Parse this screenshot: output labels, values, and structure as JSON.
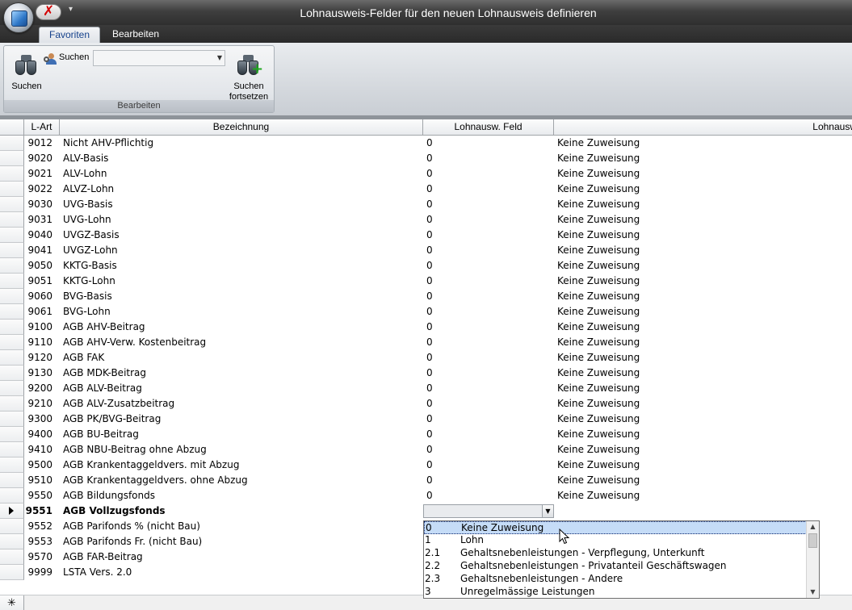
{
  "window": {
    "title": "Lohnausweis-Felder für den neuen Lohnausweis definieren"
  },
  "qat": {
    "menu_glyph": "▾"
  },
  "tabs": [
    {
      "label": "Favoriten"
    },
    {
      "label": "Bearbeiten"
    }
  ],
  "ribbon": {
    "search_button": "Suchen",
    "search_label": "Suchen",
    "search_value": "",
    "continue_button_line1": "Suchen",
    "continue_button_line2": "fortsetzen",
    "group_label": "Bearbeiten"
  },
  "grid": {
    "columns": [
      "L-Art",
      "Bezeichnung",
      "Lohnausw. Feld",
      "Lohnausw"
    ],
    "rows": [
      {
        "lart": "9012",
        "bez": "Nicht AHV-Pflichtig",
        "feld": "0",
        "text": "Keine Zuweisung"
      },
      {
        "lart": "9020",
        "bez": "ALV-Basis",
        "feld": "0",
        "text": "Keine Zuweisung"
      },
      {
        "lart": "9021",
        "bez": "ALV-Lohn",
        "feld": "0",
        "text": "Keine Zuweisung"
      },
      {
        "lart": "9022",
        "bez": "ALVZ-Lohn",
        "feld": "0",
        "text": "Keine Zuweisung"
      },
      {
        "lart": "9030",
        "bez": "UVG-Basis",
        "feld": "0",
        "text": "Keine Zuweisung"
      },
      {
        "lart": "9031",
        "bez": "UVG-Lohn",
        "feld": "0",
        "text": "Keine Zuweisung"
      },
      {
        "lart": "9040",
        "bez": "UVGZ-Basis",
        "feld": "0",
        "text": "Keine Zuweisung"
      },
      {
        "lart": "9041",
        "bez": "UVGZ-Lohn",
        "feld": "0",
        "text": "Keine Zuweisung"
      },
      {
        "lart": "9050",
        "bez": "KKTG-Basis",
        "feld": "0",
        "text": "Keine Zuweisung"
      },
      {
        "lart": "9051",
        "bez": "KKTG-Lohn",
        "feld": "0",
        "text": "Keine Zuweisung"
      },
      {
        "lart": "9060",
        "bez": "BVG-Basis",
        "feld": "0",
        "text": "Keine Zuweisung"
      },
      {
        "lart": "9061",
        "bez": "BVG-Lohn",
        "feld": "0",
        "text": "Keine Zuweisung"
      },
      {
        "lart": "9100",
        "bez": "AGB AHV-Beitrag",
        "feld": "0",
        "text": "Keine Zuweisung"
      },
      {
        "lart": "9110",
        "bez": "AGB AHV-Verw. Kostenbeitrag",
        "feld": "0",
        "text": "Keine Zuweisung"
      },
      {
        "lart": "9120",
        "bez": "AGB FAK",
        "feld": "0",
        "text": "Keine Zuweisung"
      },
      {
        "lart": "9130",
        "bez": "AGB MDK-Beitrag",
        "feld": "0",
        "text": "Keine Zuweisung"
      },
      {
        "lart": "9200",
        "bez": "AGB ALV-Beitrag",
        "feld": "0",
        "text": "Keine Zuweisung"
      },
      {
        "lart": "9210",
        "bez": "AGB ALV-Zusatzbeitrag",
        "feld": "0",
        "text": "Keine Zuweisung"
      },
      {
        "lart": "9300",
        "bez": "AGB PK/BVG-Beitrag",
        "feld": "0",
        "text": "Keine Zuweisung"
      },
      {
        "lart": "9400",
        "bez": "AGB BU-Beitrag",
        "feld": "0",
        "text": "Keine Zuweisung"
      },
      {
        "lart": "9410",
        "bez": "AGB NBU-Beitrag ohne Abzug",
        "feld": "0",
        "text": "Keine Zuweisung"
      },
      {
        "lart": "9500",
        "bez": "AGB Krankentaggeldvers. mit Abzug",
        "feld": "0",
        "text": "Keine Zuweisung"
      },
      {
        "lart": "9510",
        "bez": "AGB Krankentaggeldvers. ohne Abzug",
        "feld": "0",
        "text": "Keine Zuweisung"
      },
      {
        "lart": "9550",
        "bez": "AGB Bildungsfonds",
        "feld": "0",
        "text": "Keine Zuweisung"
      },
      {
        "lart": "9551",
        "bez": "AGB Vollzugsfonds",
        "feld": "",
        "text": ""
      },
      {
        "lart": "9552",
        "bez": "AGB Parifonds % (nicht Bau)",
        "feld": "",
        "text": ""
      },
      {
        "lart": "9553",
        "bez": "AGB Parifonds Fr. (nicht Bau)",
        "feld": "",
        "text": ""
      },
      {
        "lart": "9570",
        "bez": "AGB FAR-Beitrag",
        "feld": "",
        "text": ""
      },
      {
        "lart": "9999",
        "bez": "LSTA Vers. 2.0",
        "feld": "",
        "text": ""
      }
    ],
    "current_row_index": 24,
    "new_row_glyph": "✳"
  },
  "dropdown": {
    "options": [
      {
        "code": "0",
        "name": "Keine Zuweisung"
      },
      {
        "code": "1",
        "name": "Lohn"
      },
      {
        "code": "2.1",
        "name": "Gehaltsnebenleistungen - Verpflegung, Unterkunft"
      },
      {
        "code": "2.2",
        "name": "Gehaltsnebenleistungen - Privatanteil Geschäftswagen"
      },
      {
        "code": "2.3",
        "name": "Gehaltsnebenleistungen - Andere"
      },
      {
        "code": "3",
        "name": "Unregelmässige Leistungen"
      }
    ],
    "selected_index": 0
  }
}
